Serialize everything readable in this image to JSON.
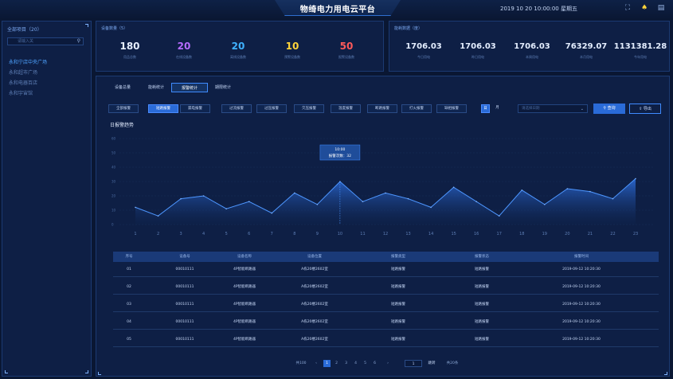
{
  "header": {
    "title": "物绮电力用电云平台",
    "datetime": "2019 10 20 10:00:00 星期五"
  },
  "sidebar": {
    "title": "全部项目（20）",
    "search_placeholder": "请输入关",
    "items": [
      {
        "label": "永和宁店中央广场",
        "active": true
      },
      {
        "label": "永和超市广场",
        "active": false
      },
      {
        "label": "永和电器百店",
        "active": false
      },
      {
        "label": "永和宇宙馆",
        "active": false
      }
    ]
  },
  "devices": {
    "title": "设备数量（5）",
    "stats": [
      {
        "value": "180",
        "label": "用品总数",
        "color": "#e6eeff"
      },
      {
        "value": "20",
        "label": "在线设备数",
        "color": "#b66cff"
      },
      {
        "value": "20",
        "label": "离线设备数",
        "color": "#3fb2ff"
      },
      {
        "value": "10",
        "label": "预警设备数",
        "color": "#ffd43a"
      },
      {
        "value": "50",
        "label": "报警设备数",
        "color": "#ff5a5a"
      }
    ]
  },
  "energy": {
    "title": "能耗数据（度）",
    "stats": [
      {
        "value": "1706.03",
        "label": "今日用电"
      },
      {
        "value": "1706.03",
        "label": "昨日用电"
      },
      {
        "value": "1706.03",
        "label": "本周用电"
      },
      {
        "value": "76329.07",
        "label": "本月用电"
      },
      {
        "value": "1131381.28",
        "label": "今年用电"
      }
    ]
  },
  "tabs": [
    {
      "label": "设备总量",
      "active": false
    },
    {
      "label": "能耗统计",
      "active": false
    },
    {
      "label": "报警统计",
      "active": true
    },
    {
      "label": "期限统计",
      "active": false
    }
  ],
  "filters": [
    {
      "label": "全部报警",
      "active": false
    },
    {
      "label": "短路报警",
      "active": true
    },
    {
      "label": "漏电报警",
      "active": false
    },
    {
      "label": "过流报警",
      "active": false
    },
    {
      "label": "过压报警",
      "active": false
    },
    {
      "label": "欠压报警",
      "active": false
    },
    {
      "label": "温度报警",
      "active": false
    },
    {
      "label": "断路报警",
      "active": false
    },
    {
      "label": "打火报警",
      "active": false
    },
    {
      "label": "缺相报警",
      "active": false
    }
  ],
  "period": {
    "day": "日",
    "month": "月"
  },
  "dropdown_placeholder": "请选择日期",
  "actions": {
    "query": "查询",
    "export": "导出"
  },
  "chart_title": "日报警趋势",
  "tooltip": {
    "time": "10:00",
    "text": "报警次数：32"
  },
  "chart_data": {
    "type": "area",
    "x": [
      1,
      2,
      3,
      4,
      5,
      6,
      7,
      8,
      9,
      10,
      11,
      12,
      13,
      14,
      15,
      16,
      17,
      18,
      19,
      20,
      21,
      22,
      23
    ],
    "y_tick_labels": [
      "60",
      "50",
      "40",
      "30",
      "20",
      "10",
      "0"
    ],
    "series": [
      {
        "values": [
          12,
          6,
          18,
          20,
          11,
          16,
          8,
          22,
          14,
          30,
          16,
          22,
          18,
          12,
          26,
          16,
          6,
          24,
          14,
          25,
          23,
          18,
          32
        ]
      }
    ],
    "ylim": [
      0,
      60
    ]
  },
  "table": {
    "headers": [
      "序号",
      "设备号",
      "设备名称",
      "设备位置",
      "报警类型",
      "报警状态",
      "报警时间"
    ],
    "rows": [
      [
        "01",
        "00010111",
        "4P智能断路器",
        "A栋20楼2602室",
        "短路报警",
        "短路报警",
        "2019-09-12 10:20:30"
      ],
      [
        "02",
        "00010111",
        "4P智能断路器",
        "A栋20楼2602室",
        "短路报警",
        "短路报警",
        "2019-09-12 10:20:30"
      ],
      [
        "03",
        "00010111",
        "4P智能断路器",
        "A栋20楼2602室",
        "短路报警",
        "短路报警",
        "2019-09-12 10:20:30"
      ],
      [
        "04",
        "00010111",
        "4P智能断路器",
        "A栋20楼2602室",
        "短路报警",
        "短路报警",
        "2019-09-12 10:20:30"
      ],
      [
        "05",
        "00010111",
        "4P智能断路器",
        "A栋20楼2602室",
        "短路报警",
        "短路报警",
        "2019-09-12 10:20:30"
      ]
    ]
  },
  "pagination": {
    "total": "共100",
    "pages": [
      "1",
      "2",
      "3",
      "4",
      "5",
      "6"
    ],
    "current": "1",
    "goto_value": "1",
    "goto_label": "跳转",
    "per_page": "共20条"
  }
}
